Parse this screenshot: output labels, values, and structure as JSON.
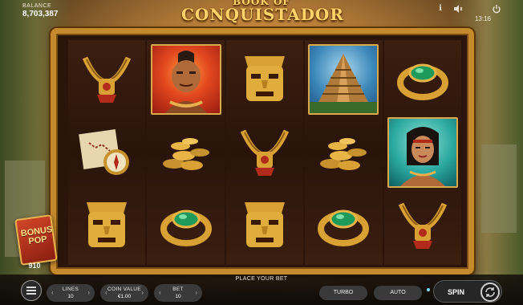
{
  "header": {
    "balance_label": "BALANCE",
    "balance_value": "8,703,387",
    "logo_line1": "BOOK OF",
    "logo_line2": "CONQUISTADOR",
    "clock": "13:16"
  },
  "icons": {
    "info": "info-icon",
    "sound": "speaker-icon",
    "power": "power-icon"
  },
  "reels": [
    [
      "gold-necklace",
      "treasure-map-compass",
      "gold-mask"
    ],
    [
      "warrior-card",
      "gold-coins",
      "emerald-ring"
    ],
    [
      "gold-mask",
      "gold-necklace",
      "gold-mask"
    ],
    [
      "pyramid-card",
      "gold-coins",
      "emerald-ring"
    ],
    [
      "emerald-ring",
      "princess-card",
      "gold-necklace"
    ]
  ],
  "bonus": {
    "label_line1": "BONUS",
    "label_line2": "POP",
    "count": "910"
  },
  "footer": {
    "message": "PLACE YOUR BET",
    "lines_label": "LINES",
    "lines_value": "10",
    "coin_label": "COIN VALUE",
    "coin_value": "€1.00",
    "bet_label": "BET",
    "bet_value": "10",
    "turbo_label": "TURBO",
    "auto_label": "AUTO",
    "spin_label": "SPIN"
  },
  "colors": {
    "frame_gold": "#c58a2b",
    "reel_bg": "#2b150b",
    "ring_emerald": "#1e9a5a"
  }
}
